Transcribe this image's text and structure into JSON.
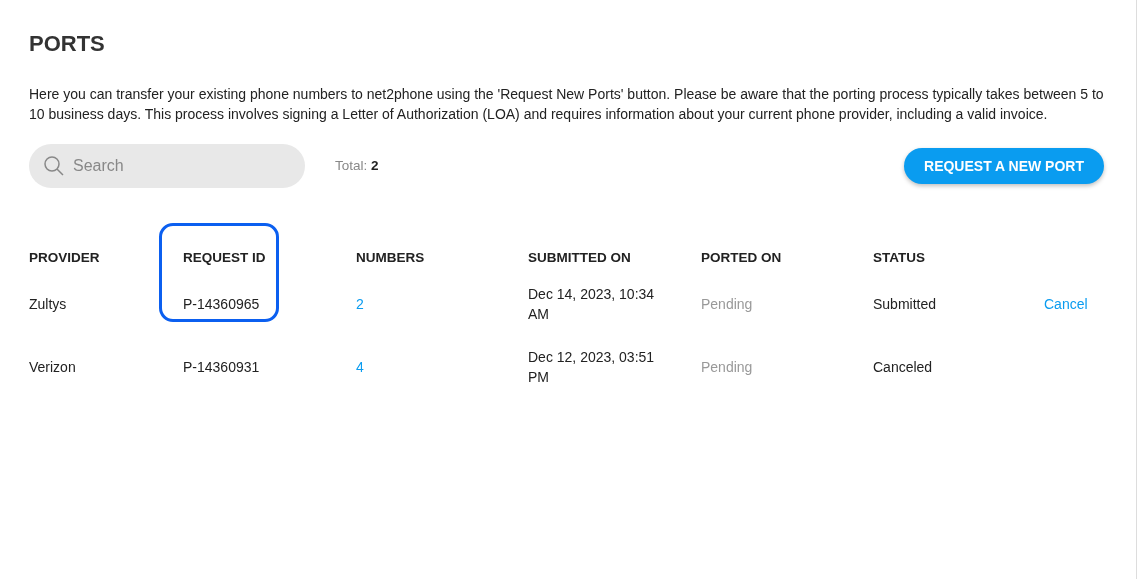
{
  "title": "PORTS",
  "description": "Here you can transfer your existing phone numbers to net2phone using the 'Request New Ports' button. Please be aware that the porting process typically takes between 5 to 10 business days. This process involves signing a Letter of Authorization (LOA) and requires information about your current phone provider, including a valid invoice.",
  "search": {
    "placeholder": "Search"
  },
  "total": {
    "label": "Total:",
    "value": "2"
  },
  "request_button": "REQUEST A NEW PORT",
  "table": {
    "columns": [
      {
        "label": "PROVIDER",
        "highlight": false
      },
      {
        "label": "REQUEST ID",
        "highlight": true
      },
      {
        "label": "NUMBERS",
        "highlight": false
      },
      {
        "label": "SUBMITTED ON",
        "highlight": false
      },
      {
        "label": "PORTED ON",
        "highlight": false
      },
      {
        "label": "STATUS",
        "highlight": false
      }
    ],
    "rows": [
      {
        "provider": "Zultys",
        "request_id": "P-14360965",
        "numbers": "2",
        "submitted_on": "Dec 14, 2023, 10:34 AM",
        "ported_on": "Pending",
        "status": "Submitted",
        "action": "Cancel"
      },
      {
        "provider": "Verizon",
        "request_id": "P-14360931",
        "numbers": "4",
        "submitted_on": "Dec 12, 2023, 03:51 PM",
        "ported_on": "Pending",
        "status": "Canceled"
      }
    ]
  }
}
